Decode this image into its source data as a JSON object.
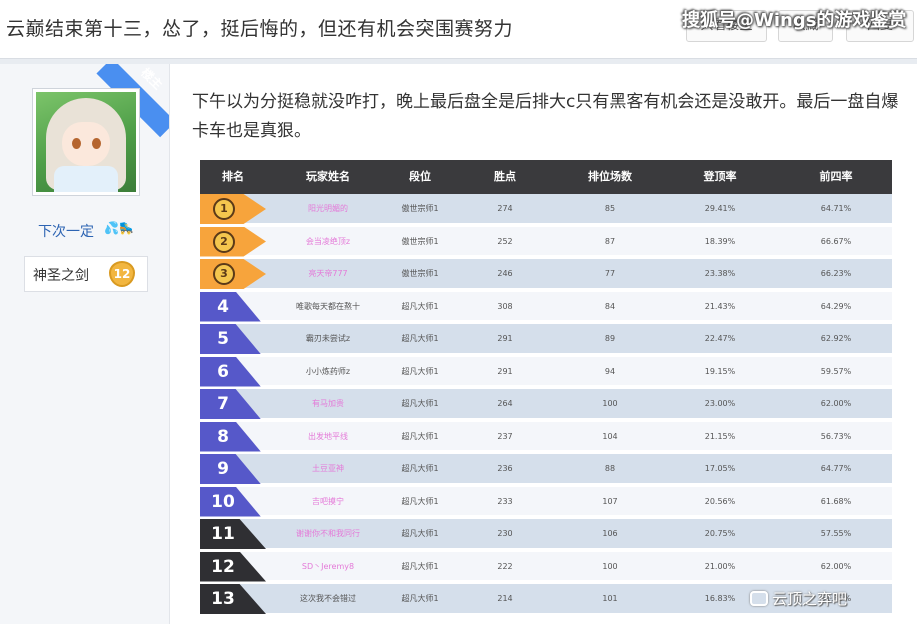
{
  "thread": {
    "title": "云巅结束第十三，怂了，挺后悔的，但还有机会突围赛努力",
    "buttons": {
      "owner_only": "只看楼主",
      "favorite": "收藏",
      "reply": "回复"
    }
  },
  "watermark_top": "搜狐号@Wings的游戏鉴赏",
  "author": {
    "ribbon": "楼主",
    "name": "下次一定",
    "name_deco": "💦🛼",
    "badge_label": "神圣之剑",
    "badge_level": "12"
  },
  "post": {
    "text": "下午以为分挺稳就没咋打，晚上最后盘全是后排大c只有黑客有机会还是没敢开。最后一盘自爆卡车也是真狠。"
  },
  "ranking": {
    "headers": [
      "排名",
      "玩家姓名",
      "段位",
      "胜点",
      "排位场数",
      "登顶率",
      "前四率"
    ],
    "rows": [
      {
        "rank": "1",
        "name": "阳光明媚的",
        "tier": "傲世宗师1",
        "points": "274",
        "games": "85",
        "top1": "29.41%",
        "top4": "64.71%"
      },
      {
        "rank": "2",
        "name": "会当凌绝顶z",
        "tier": "傲世宗师1",
        "points": "252",
        "games": "87",
        "top1": "18.39%",
        "top4": "66.67%"
      },
      {
        "rank": "3",
        "name": "亮天帝777",
        "tier": "傲世宗师1",
        "points": "246",
        "games": "77",
        "top1": "23.38%",
        "top4": "66.23%"
      },
      {
        "rank": "4",
        "name": "唯歌每天都在熬十",
        "tier": "超凡大师1",
        "points": "308",
        "games": "84",
        "top1": "21.43%",
        "top4": "64.29%"
      },
      {
        "rank": "5",
        "name": "霸刃未尝试z",
        "tier": "超凡大师1",
        "points": "291",
        "games": "89",
        "top1": "22.47%",
        "top4": "62.92%"
      },
      {
        "rank": "6",
        "name": "小小炼药师z",
        "tier": "超凡大师1",
        "points": "291",
        "games": "94",
        "top1": "19.15%",
        "top4": "59.57%"
      },
      {
        "rank": "7",
        "name": "有马加贵",
        "tier": "超凡大师1",
        "points": "264",
        "games": "100",
        "top1": "23.00%",
        "top4": "62.00%"
      },
      {
        "rank": "8",
        "name": "出发地平线",
        "tier": "超凡大师1",
        "points": "237",
        "games": "104",
        "top1": "21.15%",
        "top4": "56.73%"
      },
      {
        "rank": "9",
        "name": "土豆亚神",
        "tier": "超凡大师1",
        "points": "236",
        "games": "88",
        "top1": "17.05%",
        "top4": "64.77%"
      },
      {
        "rank": "10",
        "name": "吉吧摸宁",
        "tier": "超凡大师1",
        "points": "233",
        "games": "107",
        "top1": "20.56%",
        "top4": "61.68%"
      },
      {
        "rank": "11",
        "name": "谢谢你不和我同行",
        "tier": "超凡大师1",
        "points": "230",
        "games": "106",
        "top1": "20.75%",
        "top4": "57.55%"
      },
      {
        "rank": "12",
        "name": "SD丶Jeremy8",
        "tier": "超凡大师1",
        "points": "222",
        "games": "100",
        "top1": "21.00%",
        "top4": "62.00%"
      },
      {
        "rank": "13",
        "name": "这次我不会错过",
        "tier": "超凡大师1",
        "points": "214",
        "games": "101",
        "top1": "16.83%",
        "top4": "61.39%"
      }
    ],
    "watermark": "云顶之弈吧"
  },
  "colors": {
    "gold": "#f7a43c",
    "blue": "#5658c9",
    "dark": "#2f2f33",
    "pink_name": "#e47ad8",
    "link": "#2d64b3"
  }
}
